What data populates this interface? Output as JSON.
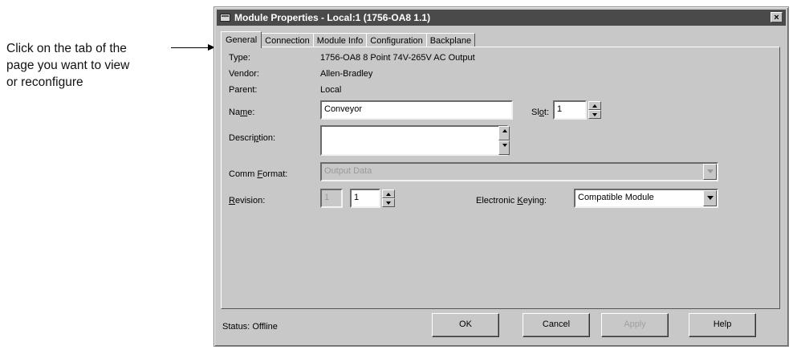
{
  "callout": {
    "lines": [
      "Click on the tab of the",
      "page you want to view",
      "or reconfigure"
    ]
  },
  "window": {
    "title": "Module Properties - Local:1 (1756-OA8 1.1)",
    "close_glyph": "×"
  },
  "tabs": [
    {
      "label": "General",
      "active": true
    },
    {
      "label": "Connection"
    },
    {
      "label": "Module Info"
    },
    {
      "label": "Configuration"
    },
    {
      "label": "Backplane"
    }
  ],
  "general": {
    "type_label": "Type:",
    "type_value": "1756-OA8 8 Point 74V-265V AC Output",
    "vendor_label": "Vendor:",
    "vendor_value": "Allen-Bradley",
    "parent_label": "Parent:",
    "parent_value": "Local",
    "name_label_pre": "Na",
    "name_label_u": "m",
    "name_label_post": "e:",
    "name_value": "Conveyor",
    "slot_label_pre": "Sl",
    "slot_label_u": "o",
    "slot_label_post": "t:",
    "slot_value": "1",
    "description_label_pre": "Descri",
    "description_label_u": "p",
    "description_label_post": "tion:",
    "description_value": "",
    "comm_format_label_pre": "Comm ",
    "comm_format_label_u": "F",
    "comm_format_label_post": "ormat:",
    "comm_format_value": "Output Data",
    "revision_label_u": "R",
    "revision_label_post": "evision:",
    "revision_major": "1",
    "revision_minor": "1",
    "keying_label_pre": "Electronic ",
    "keying_label_u": "K",
    "keying_label_post": "eying:",
    "keying_value": "Compatible Module"
  },
  "status": {
    "label": "Status:",
    "value": "Offline"
  },
  "buttons": {
    "ok": "OK",
    "cancel": "Cancel",
    "apply": "Apply",
    "help": "Help"
  }
}
